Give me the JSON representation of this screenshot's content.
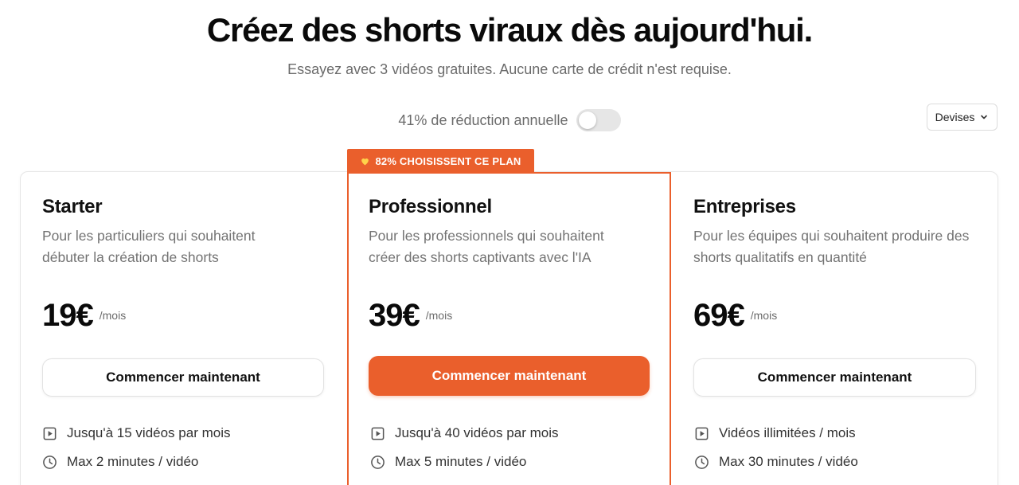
{
  "hero": {
    "title": "Créez des shorts viraux dès aujourd'hui.",
    "subtitle": "Essayez avec 3 vidéos gratuites. Aucune carte de crédit n'est requise."
  },
  "billing": {
    "toggle_label": "41% de réduction annuelle",
    "annual_enabled": false
  },
  "currency": {
    "label": "Devises"
  },
  "badge": {
    "text": "82% CHOISISSENT CE PLAN",
    "icon": "heart-icon",
    "color": "#ea5f2c"
  },
  "accent_color": "#ea5f2c",
  "plans": [
    {
      "name": "Starter",
      "description": "Pour les particuliers qui souhaitent débuter la création de shorts",
      "price": "19€",
      "period": "/mois",
      "cta": "Commencer maintenant",
      "features": [
        {
          "icon": "play-icon",
          "text": "Jusqu'à 15 vidéos par mois"
        },
        {
          "icon": "clock-icon",
          "text": "Max 2 minutes / vidéo"
        }
      ]
    },
    {
      "name": "Professionnel",
      "description": "Pour les professionnels qui souhaitent créer des shorts captivants avec l'IA",
      "price": "39€",
      "period": "/mois",
      "cta": "Commencer maintenant",
      "features": [
        {
          "icon": "play-icon",
          "text": "Jusqu'à 40 vidéos par mois"
        },
        {
          "icon": "clock-icon",
          "text": "Max 5 minutes / vidéo"
        }
      ]
    },
    {
      "name": "Entreprises",
      "description": "Pour les équipes qui souhaitent produire des shorts qualitatifs en quantité",
      "price": "69€",
      "period": "/mois",
      "cta": "Commencer maintenant",
      "features": [
        {
          "icon": "play-icon",
          "text": "Vidéos illimitées / mois"
        },
        {
          "icon": "clock-icon",
          "text": "Max 30 minutes / vidéo"
        }
      ]
    }
  ]
}
